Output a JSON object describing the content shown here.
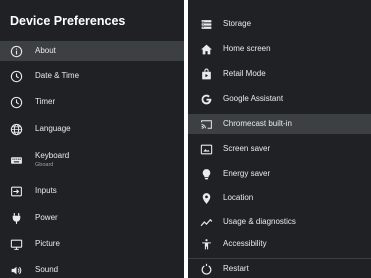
{
  "left_panel": {
    "title": "Device Preferences",
    "items": [
      {
        "label": "About",
        "icon": "info-icon",
        "selected": true
      },
      {
        "label": "Date & Time",
        "icon": "clock-icon"
      },
      {
        "label": "Timer",
        "icon": "clock-icon"
      },
      {
        "label": "Language",
        "icon": "globe-icon"
      },
      {
        "label": "Keyboard",
        "sublabel": "Gboard",
        "icon": "keyboard-icon"
      },
      {
        "label": "Inputs",
        "icon": "input-icon"
      },
      {
        "label": "Power",
        "icon": "power-plug-icon"
      },
      {
        "label": "Picture",
        "icon": "monitor-icon"
      },
      {
        "label": "Sound",
        "icon": "speaker-icon"
      }
    ]
  },
  "right_panel": {
    "items": [
      {
        "label": "Storage",
        "icon": "storage-icon"
      },
      {
        "label": "Home screen",
        "icon": "home-icon"
      },
      {
        "label": "Retail Mode",
        "icon": "retail-bag-icon"
      },
      {
        "label": "Google Assistant",
        "icon": "google-g-icon"
      },
      {
        "label": "Chromecast built-in",
        "icon": "cast-icon",
        "selected": true
      },
      {
        "label": "Screen saver",
        "icon": "screen-saver-icon"
      },
      {
        "label": "Energy saver",
        "icon": "lightbulb-icon"
      },
      {
        "label": "Location",
        "icon": "location-pin-icon"
      },
      {
        "label": "Usage & diagnostics",
        "icon": "diagnostics-icon"
      },
      {
        "label": "Accessibility",
        "icon": "accessibility-icon"
      },
      {
        "label": "Restart",
        "icon": "restart-icon"
      }
    ]
  },
  "colors": {
    "panel_bg": "#202124",
    "selected_bg": "#3c4043",
    "text": "#e8eaed",
    "subtext": "#9aa0a6",
    "divider": "#ffffff"
  }
}
